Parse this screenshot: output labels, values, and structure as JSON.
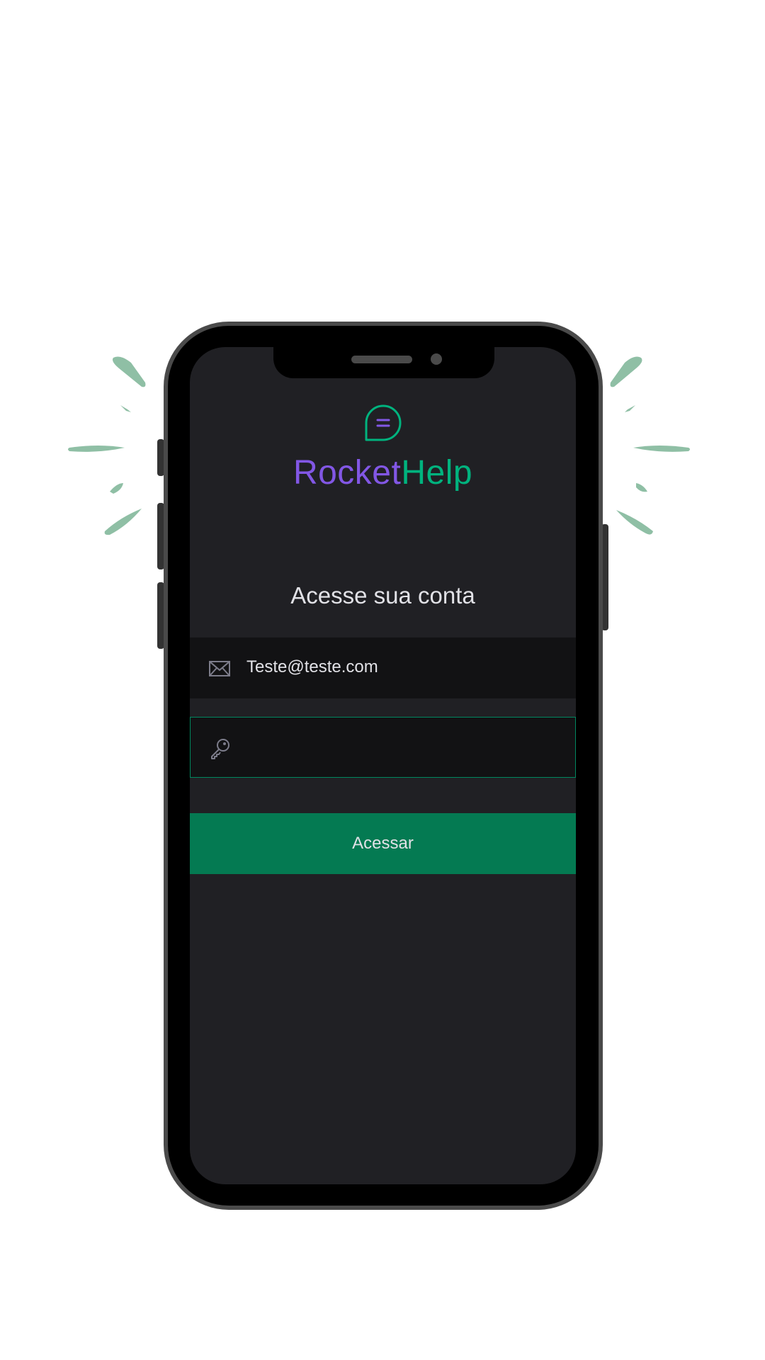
{
  "app": {
    "brand_part1": "Rocket",
    "brand_part2": "Help",
    "logo_icon": "chat-bubble-icon"
  },
  "login": {
    "heading": "Acesse sua conta",
    "email": {
      "icon": "envelope-icon",
      "value": "Teste@teste.com"
    },
    "password": {
      "icon": "key-icon",
      "value": ""
    },
    "submit_label": "Acessar"
  },
  "colors": {
    "background": "#202024",
    "input_background": "#121214",
    "brand_purple": "#8257e5",
    "brand_green": "#00b37e",
    "button_green": "#047a52",
    "focus_border": "#00875f",
    "sparkle": "#8fbfa5"
  }
}
